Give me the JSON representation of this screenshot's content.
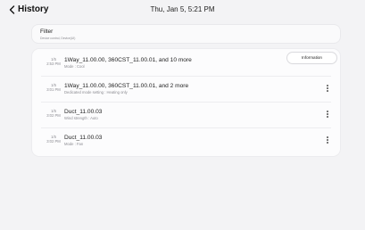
{
  "header": {
    "title": "History",
    "datetime": "Thu, Jan 5, 5:21 PM"
  },
  "filter": {
    "label": "Filter",
    "subtext": "Device control, Device(UI)"
  },
  "popup": {
    "information_label": "Information"
  },
  "history": [
    {
      "date": "1/5",
      "time": "2:53 PM",
      "title": "1Way_11.00.00, 360CST_11.00.01, and 10 more",
      "subtitle": "Mode : Cool"
    },
    {
      "date": "1/5",
      "time": "3:01 PM",
      "title": "1Way_11.00.00, 360CST_11.00.01, and 2 more",
      "subtitle": "Dedicated mode setting : Heating only"
    },
    {
      "date": "1/5",
      "time": "3:02 PM",
      "title": "Duct_11.00.03",
      "subtitle": "Wind strength : Auto"
    },
    {
      "date": "1/5",
      "time": "3:02 PM",
      "title": "Duct_11.00.03",
      "subtitle": "Mode : Fan"
    }
  ]
}
